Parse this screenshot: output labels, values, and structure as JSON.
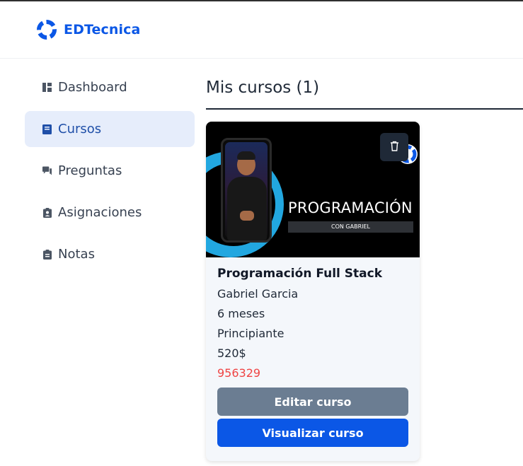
{
  "header": {
    "brand": "EDTecnica"
  },
  "sidebar": {
    "items": [
      {
        "label": "Dashboard",
        "icon": "dashboard-icon",
        "active": false
      },
      {
        "label": "Cursos",
        "icon": "book-icon",
        "active": true
      },
      {
        "label": "Preguntas",
        "icon": "chat-icon",
        "active": false
      },
      {
        "label": "Asignaciones",
        "icon": "assignment-icon",
        "active": false
      },
      {
        "label": "Notas",
        "icon": "clipboard-icon",
        "active": false
      }
    ]
  },
  "main": {
    "title": "Mis cursos (1)",
    "courses": [
      {
        "thumbnail": {
          "headline": "PROGRAMACIÓN",
          "subline": "CON GABRIEL"
        },
        "title": "Programación Full Stack",
        "instructor": "Gabriel Garcia",
        "duration": "6 meses",
        "level": "Principiante",
        "price": "520$",
        "code": "956329",
        "edit_label": "Editar curso",
        "view_label": "Visualizar curso"
      }
    ]
  },
  "colors": {
    "brand": "#0b57e6",
    "active_bg": "#e6edfb",
    "edit_button": "#6b7d92",
    "view_button": "#0b57e6",
    "code_text": "#ef4444"
  }
}
